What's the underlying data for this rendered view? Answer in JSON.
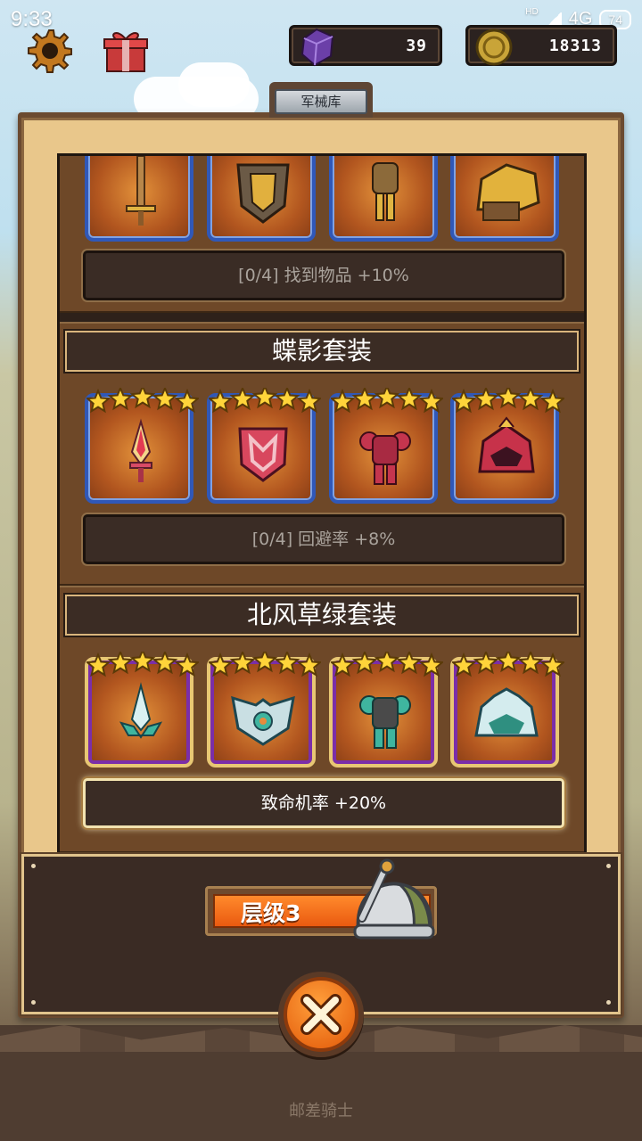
{
  "status_bar": {
    "time": "9:33",
    "hd": "HD",
    "network": "4G",
    "battery": "74"
  },
  "hud": {
    "gems": "39",
    "coins": "18313"
  },
  "panel": {
    "title": "军械库"
  },
  "sets": [
    {
      "name": "",
      "bonus": "[0/4] 找到物品 +10%",
      "bonus_active": false,
      "items": [
        "sword-icon",
        "shield-icon",
        "armor-icon",
        "helmet-icon"
      ]
    },
    {
      "name": "蝶影套装",
      "bonus": "[0/4] 回避率 +8%",
      "bonus_active": false,
      "stars": 5,
      "items": [
        "dagger-icon",
        "shield-icon",
        "armor-icon",
        "helmet-icon"
      ]
    },
    {
      "name": "北风草绿套装",
      "bonus": "致命机率 +20%",
      "bonus_active": true,
      "stars": 5,
      "items": [
        "sword-icon",
        "shield-icon",
        "armor-icon",
        "helmet-icon"
      ]
    }
  ],
  "tier": {
    "label": "层级3"
  },
  "footer": {
    "name": "邮差骑士"
  },
  "colors": {
    "parchment": "#e9c78b",
    "slot_blue": "#3058b8",
    "slot_purple": "#7b2ea8",
    "tier_orange": "#ea5a10",
    "star_gold": "#ffd43a"
  }
}
